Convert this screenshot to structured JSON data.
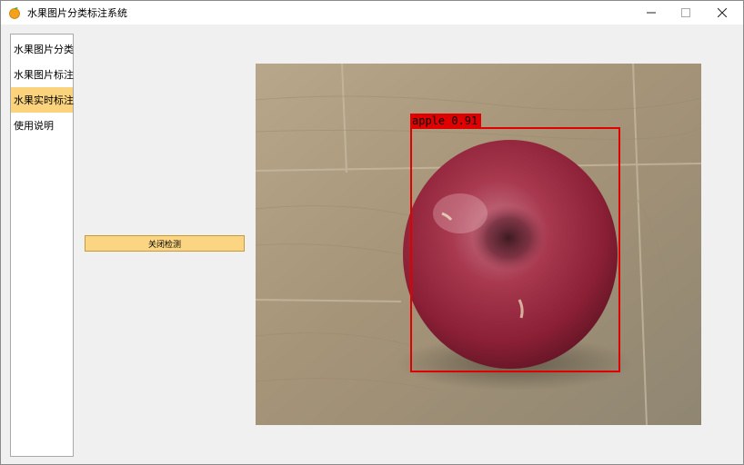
{
  "window": {
    "title": "水果图片分类标注系统",
    "app_icon": "orange-fruit-icon",
    "controls": {
      "minimize": "─",
      "maximize": "☐",
      "close": "✕"
    }
  },
  "sidebar": {
    "items": [
      {
        "label": "水果图片分类",
        "selected": false
      },
      {
        "label": "水果图片标注",
        "selected": false
      },
      {
        "label": "水果实时标注",
        "selected": true
      },
      {
        "label": "使用说明",
        "selected": false
      }
    ]
  },
  "controls": {
    "action_button_label": "关闭检测"
  },
  "camera": {
    "detection": {
      "label": "apple 0.91",
      "box_color": "#e00000"
    }
  },
  "colors": {
    "selected_item": "#fbd37c",
    "button": "#fcd582",
    "window_bg": "#f0f0f0"
  }
}
